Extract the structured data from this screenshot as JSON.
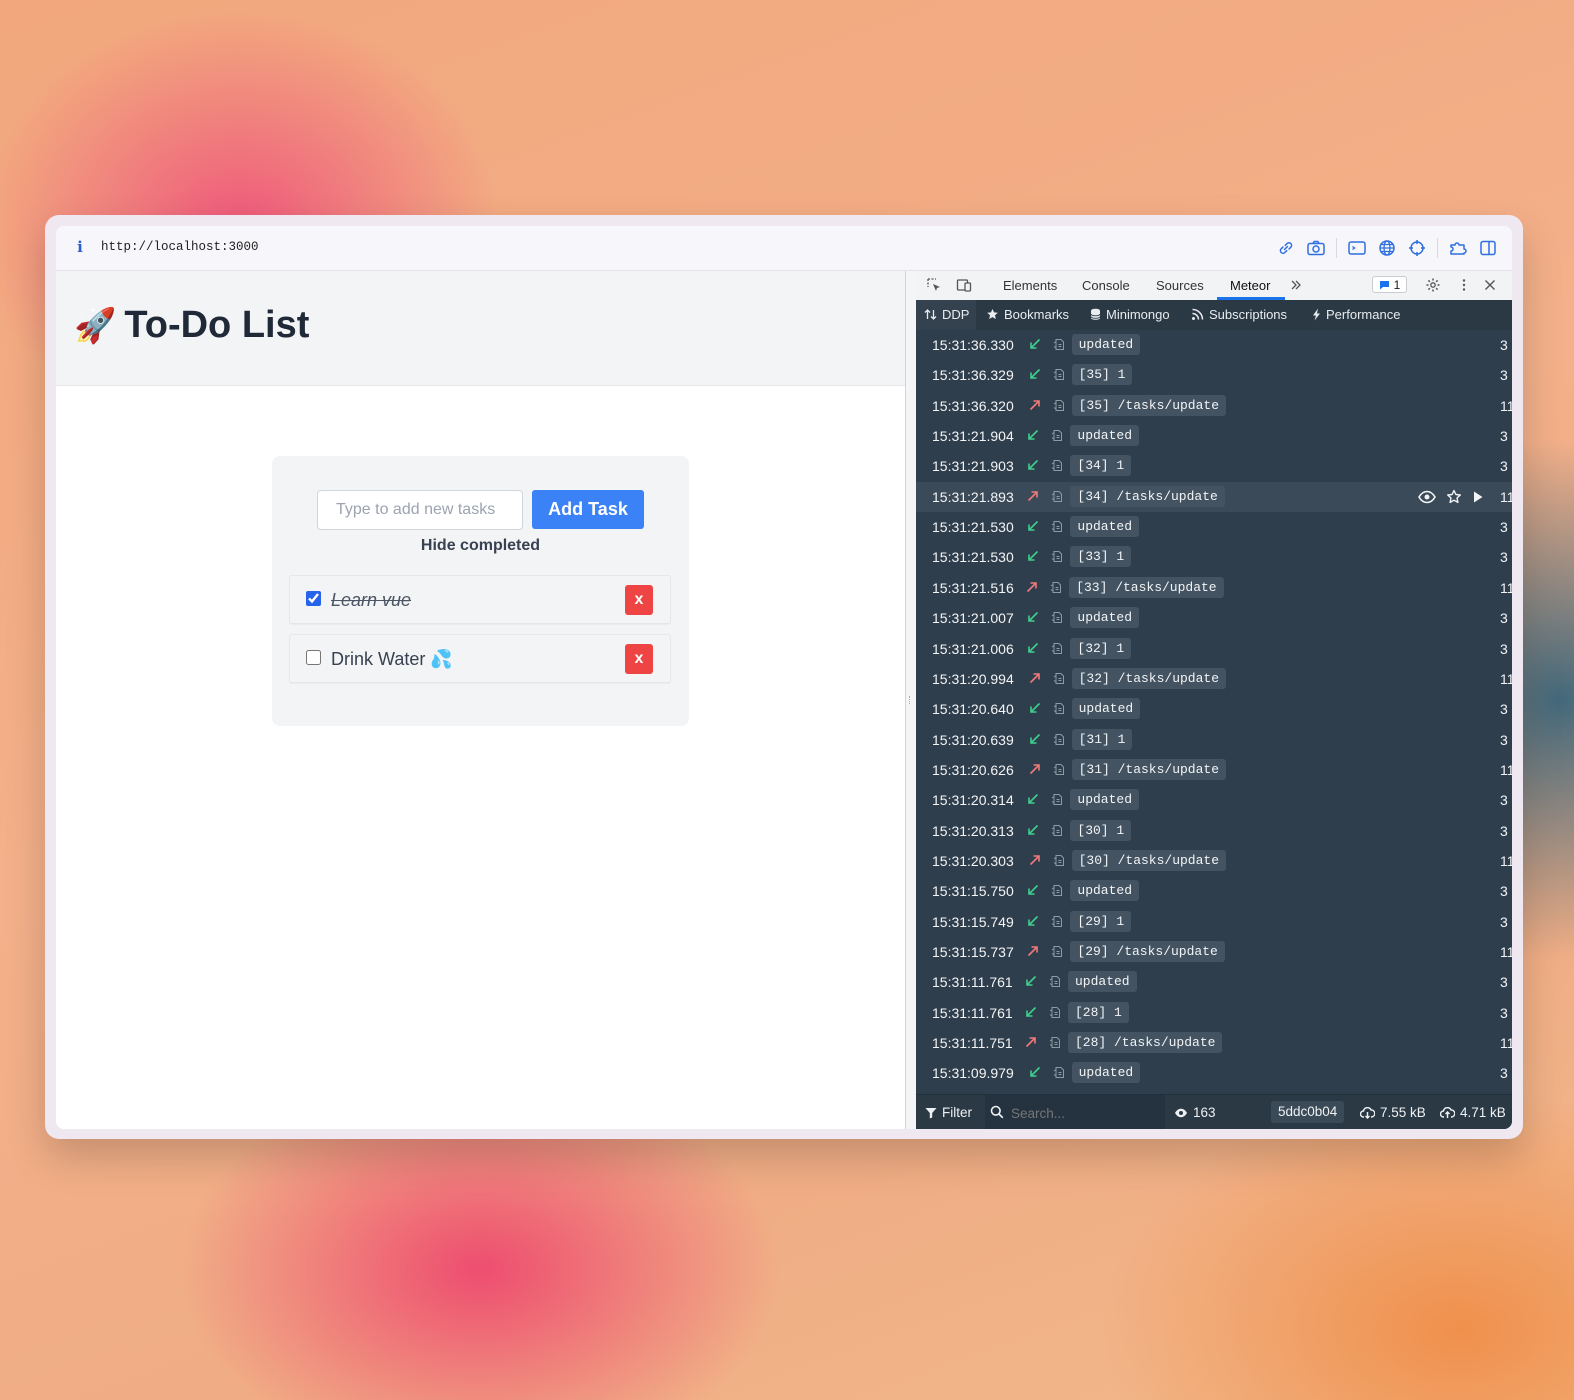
{
  "browser": {
    "url": "http://localhost:3000",
    "toolbar_icons": [
      "link-icon",
      "camera-icon",
      "terminal-icon",
      "globe-icon",
      "crosshair-icon",
      "extension-icon",
      "split-view-icon"
    ]
  },
  "app": {
    "title": "To-Do List",
    "title_emoji": "🚀",
    "input_placeholder": "Type to add new tasks",
    "add_button": "Add Task",
    "hide_completed": "Hide completed",
    "tasks": [
      {
        "text": "Learn vue",
        "checked": true
      },
      {
        "text": "Drink Water 💦",
        "checked": false
      }
    ],
    "delete_label": "x"
  },
  "devtools": {
    "tabs": [
      "Elements",
      "Console",
      "Sources",
      "Meteor"
    ],
    "active_tab": "Meteor",
    "more_label": ">>",
    "message_count": "1",
    "meteor_tabs": [
      "DDP",
      "Bookmarks",
      "Minimongo",
      "Subscriptions",
      "Performance"
    ],
    "active_meteor_tab": "DDP",
    "log": [
      {
        "time": "15:31:36.330",
        "dir": "in",
        "msg": "updated",
        "size": "3"
      },
      {
        "time": "15:31:36.329",
        "dir": "in",
        "msg": "[35] 1",
        "size": "3"
      },
      {
        "time": "15:31:36.320",
        "dir": "out",
        "msg": "[35] /tasks/update",
        "size": "11"
      },
      {
        "time": "15:31:21.904",
        "dir": "in",
        "msg": "updated",
        "size": "3"
      },
      {
        "time": "15:31:21.903",
        "dir": "in",
        "msg": "[34] 1",
        "size": "3"
      },
      {
        "time": "15:31:21.893",
        "dir": "out",
        "msg": "[34] /tasks/update",
        "size": "11",
        "highlighted": true
      },
      {
        "time": "15:31:21.530",
        "dir": "in",
        "msg": "updated",
        "size": "3"
      },
      {
        "time": "15:31:21.530",
        "dir": "in",
        "msg": "[33] 1",
        "size": "3"
      },
      {
        "time": "15:31:21.516",
        "dir": "out",
        "msg": "[33] /tasks/update",
        "size": "11"
      },
      {
        "time": "15:31:21.007",
        "dir": "in",
        "msg": "updated",
        "size": "3"
      },
      {
        "time": "15:31:21.006",
        "dir": "in",
        "msg": "[32] 1",
        "size": "3"
      },
      {
        "time": "15:31:20.994",
        "dir": "out",
        "msg": "[32] /tasks/update",
        "size": "11"
      },
      {
        "time": "15:31:20.640",
        "dir": "in",
        "msg": "updated",
        "size": "3"
      },
      {
        "time": "15:31:20.639",
        "dir": "in",
        "msg": "[31] 1",
        "size": "3"
      },
      {
        "time": "15:31:20.626",
        "dir": "out",
        "msg": "[31] /tasks/update",
        "size": "11"
      },
      {
        "time": "15:31:20.314",
        "dir": "in",
        "msg": "updated",
        "size": "3"
      },
      {
        "time": "15:31:20.313",
        "dir": "in",
        "msg": "[30] 1",
        "size": "3"
      },
      {
        "time": "15:31:20.303",
        "dir": "out",
        "msg": "[30] /tasks/update",
        "size": "11"
      },
      {
        "time": "15:31:15.750",
        "dir": "in",
        "msg": "updated",
        "size": "3"
      },
      {
        "time": "15:31:15.749",
        "dir": "in",
        "msg": "[29] 1",
        "size": "3"
      },
      {
        "time": "15:31:15.737",
        "dir": "out",
        "msg": "[29] /tasks/update",
        "size": "11"
      },
      {
        "time": "15:31:11.761",
        "dir": "in",
        "msg": "updated",
        "size": "3"
      },
      {
        "time": "15:31:11.761",
        "dir": "in",
        "msg": "[28] 1",
        "size": "3"
      },
      {
        "time": "15:31:11.751",
        "dir": "out",
        "msg": "[28] /tasks/update",
        "size": "11"
      },
      {
        "time": "15:31:09.979",
        "dir": "in",
        "msg": "updated",
        "size": "3"
      }
    ],
    "status": {
      "filter": "Filter",
      "search_placeholder": "Search...",
      "count": "163",
      "hash": "5ddc0b04",
      "inbound": "7.55 kB",
      "outbound": "4.71 kB"
    },
    "colors": {
      "inbound": "#3ecf8e",
      "outbound": "#f07a7a",
      "panel": "#2f3e4c"
    }
  }
}
